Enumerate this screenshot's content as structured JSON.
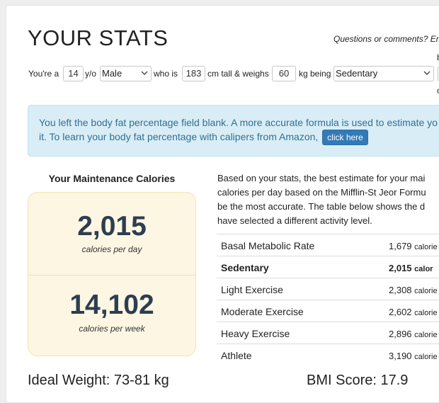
{
  "header": {
    "title": "YOUR STATS",
    "questions": "Questions or comments? Em"
  },
  "form": {
    "youre_a": "You're a",
    "age": "14",
    "yo": "y/o",
    "gender": "Male",
    "who_is": "who is",
    "height": "183",
    "cm_tall": "cm tall & weighs",
    "weight": "60",
    "kg_being": "kg being",
    "activity": "Sedentary",
    "extra_top": "b",
    "extra_bottom": "c"
  },
  "alert": {
    "line1": "You left the body fat percentage field blank. A more accurate formula is used to estimate yo",
    "line2": "it. To learn your body fat percentage with calipers from Amazon,",
    "button": "click here"
  },
  "maintenance": {
    "title": "Your Maintenance Calories",
    "per_day_value": "2,015",
    "per_day_label": "calories per day",
    "per_week_value": "14,102",
    "per_week_label": "calories per week"
  },
  "description": {
    "line1": "Based on your stats, the best estimate for your mai",
    "line2": "calories per day based on the Mifflin-St Jeor Formu",
    "line3": "be the most accurate. The table below shows the d",
    "line4": "have selected a different activity level."
  },
  "table": {
    "rows": [
      {
        "name": "Basal Metabolic Rate",
        "value": "1,679",
        "unit": "calorie"
      },
      {
        "name": "Sedentary",
        "value": "2,015",
        "unit": "calor"
      },
      {
        "name": "Light Exercise",
        "value": "2,308",
        "unit": "calorie"
      },
      {
        "name": "Moderate Exercise",
        "value": "2,602",
        "unit": "calorie"
      },
      {
        "name": "Heavy Exercise",
        "value": "2,896",
        "unit": "calorie"
      },
      {
        "name": "Athlete",
        "value": "3,190",
        "unit": "calorie"
      }
    ]
  },
  "footer": {
    "ideal_weight": "Ideal Weight: 73-81 kg",
    "bmi": "BMI Score: 17.9"
  }
}
